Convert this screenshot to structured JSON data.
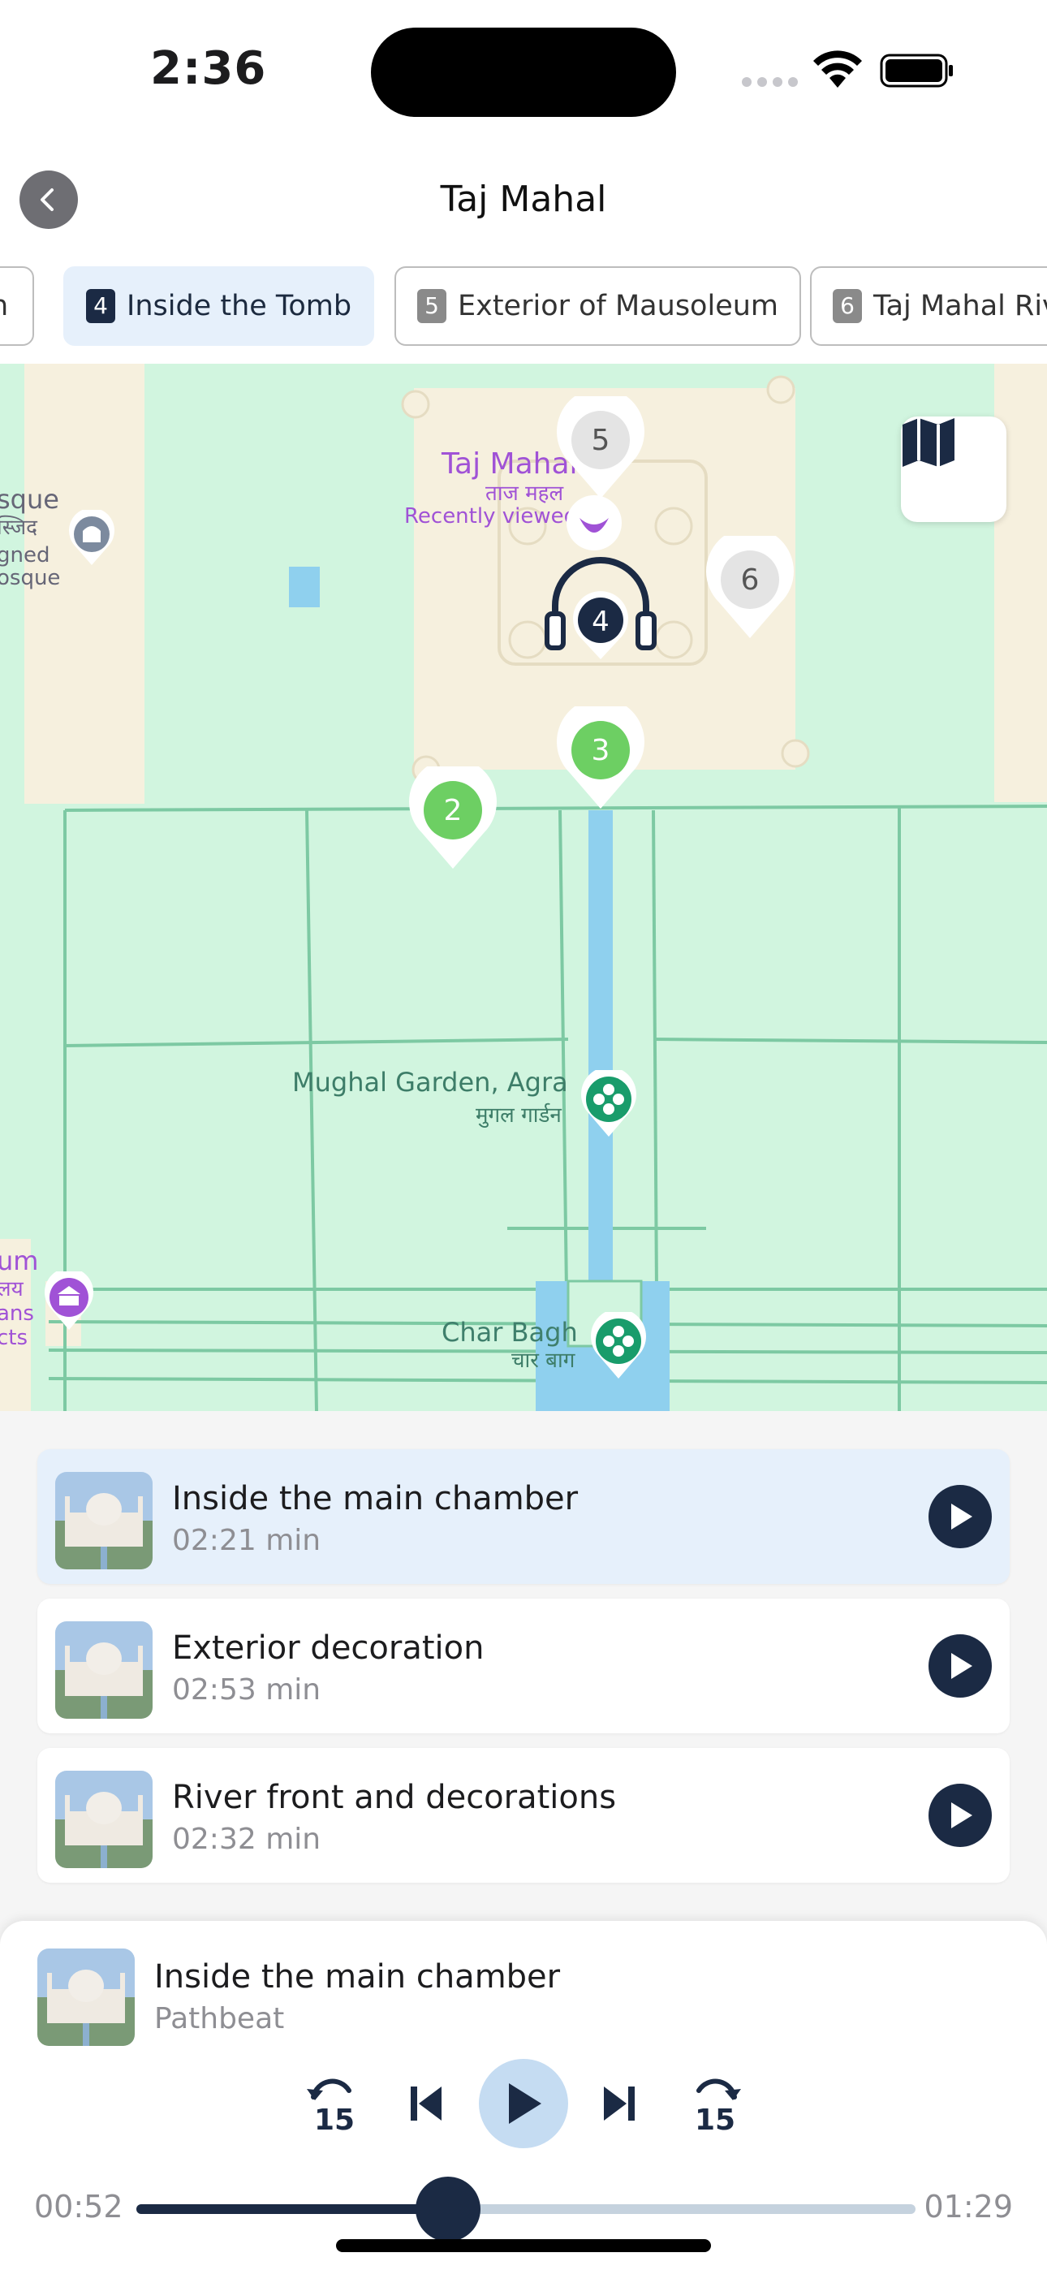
{
  "status_bar": {
    "time": "2:36"
  },
  "header": {
    "title": "Taj Mahal"
  },
  "tabs": [
    {
      "num": "",
      "label": "n"
    },
    {
      "num": "4",
      "label": "Inside the Tomb",
      "active": true
    },
    {
      "num": "5",
      "label": "Exterior of Mausoleum"
    },
    {
      "num": "6",
      "label": "Taj Mahal Riv"
    }
  ],
  "map": {
    "labels": {
      "taj_en": "Taj Mahal",
      "taj_hi": "ताज महल",
      "recently_viewed": "Recently viewed",
      "mosque_1": "sque",
      "mosque_2": "स्जिद",
      "mosque_3": "gned",
      "mosque_4": "osque",
      "garden_en": "Mughal Garden, Agra",
      "garden_hi": "मुगल गार्डन",
      "charbagh_en": "Char Bagh",
      "charbagh_hi": "चार बाग",
      "museum_1": "um",
      "museum_2": "लय",
      "museum_3": "ans",
      "museum_4": "cts"
    },
    "pins": [
      {
        "num": "2",
        "state": "visited"
      },
      {
        "num": "3",
        "state": "visited"
      },
      {
        "num": "4",
        "state": "playing"
      },
      {
        "num": "5",
        "state": "upcoming"
      },
      {
        "num": "6",
        "state": "upcoming"
      }
    ],
    "layer_button_icon": "map-icon"
  },
  "tracks": [
    {
      "title": "Inside the main chamber",
      "duration": "02:21 min",
      "active": true
    },
    {
      "title": "Exterior decoration",
      "duration": "02:53 min"
    },
    {
      "title": "River front and decorations",
      "duration": "02:32 min"
    }
  ],
  "player": {
    "title": "Inside the main chamber",
    "subtitle": "Pathbeat",
    "elapsed": "00:52",
    "total": "01:29",
    "progress": 0.4,
    "skip_back_label": "15",
    "skip_forward_label": "15"
  },
  "colors": {
    "accent": "#1b2a44",
    "active_bg": "#e6f0fb",
    "map_green": "#d1f5df",
    "visited_pin": "#6dcf63"
  }
}
